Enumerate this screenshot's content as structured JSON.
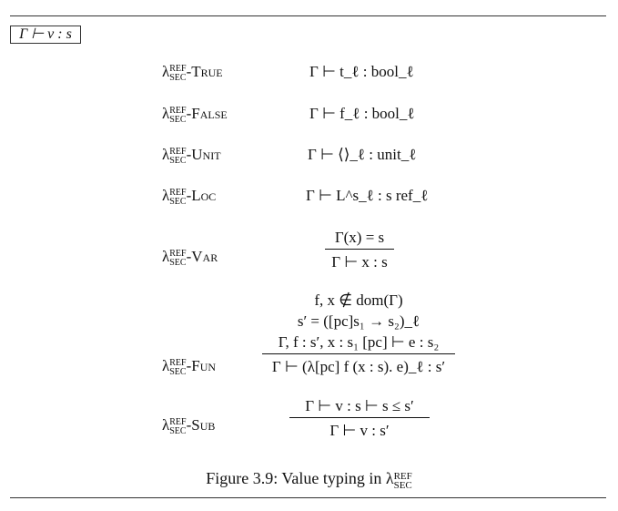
{
  "judgment_form": "Γ ⊢ v : s",
  "rules": [
    {
      "prefix": "λ",
      "sup": "REF",
      "sub": "SEC",
      "name": "-True",
      "conclusion": "Γ ⊢ t_ℓ : bool_ℓ"
    },
    {
      "prefix": "λ",
      "sup": "REF",
      "sub": "SEC",
      "name": "-False",
      "conclusion": "Γ ⊢ f_ℓ : bool_ℓ"
    },
    {
      "prefix": "λ",
      "sup": "REF",
      "sub": "SEC",
      "name": "-Unit",
      "conclusion": "Γ ⊢ ⟨⟩_ℓ : unit_ℓ"
    },
    {
      "prefix": "λ",
      "sup": "REF",
      "sub": "SEC",
      "name": "-Loc",
      "conclusion": "Γ ⊢ L^s_ℓ : s ref_ℓ"
    },
    {
      "prefix": "λ",
      "sup": "REF",
      "sub": "SEC",
      "name": "-Var",
      "premises": [
        "Γ(x) = s"
      ],
      "conclusion": "Γ ⊢ x : s"
    },
    {
      "prefix": "λ",
      "sup": "REF",
      "sub": "SEC",
      "name": "-Fun",
      "premises": [
        "f, x ∉ dom(Γ)",
        "s′ = ([pc]s₁ → s₂)_ℓ",
        "Γ, f : s′, x : s₁ [pc] ⊢ e : s₂"
      ],
      "conclusion": "Γ ⊢ (λ[pc] f (x : s). e)_ℓ : s′"
    },
    {
      "prefix": "λ",
      "sup": "REF",
      "sub": "SEC",
      "name": "-Sub",
      "premises": [
        "Γ ⊢ v : s   ⊢ s ≤ s′"
      ],
      "conclusion": "Γ ⊢ v : s′"
    }
  ],
  "caption": {
    "text": "Figure 3.9: Value typing in λ",
    "sup": "REF",
    "sub": "SEC"
  }
}
